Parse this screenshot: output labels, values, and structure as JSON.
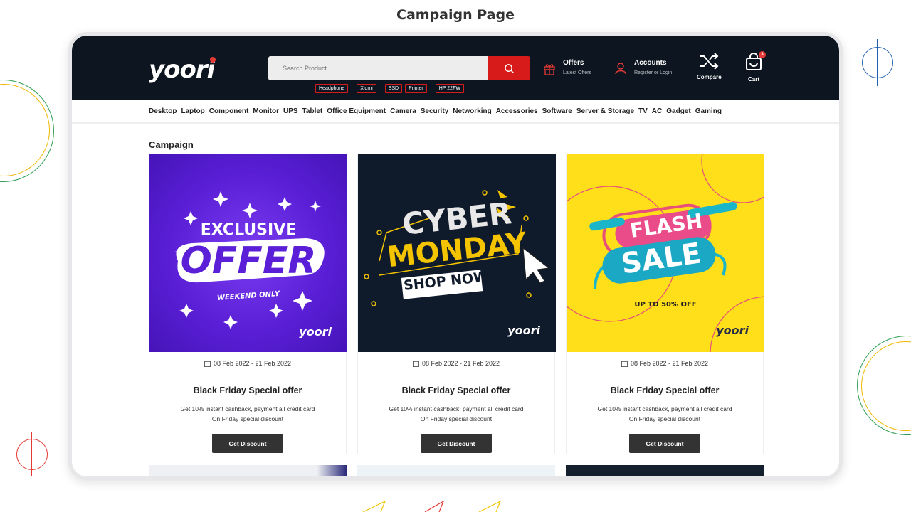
{
  "page_heading": "Campaign Page",
  "header": {
    "logo": "yoori",
    "search_placeholder": "Search Product",
    "tags": [
      "Headphone",
      "Xiomi",
      "SSD",
      "Printer",
      "HP 22FW"
    ],
    "offers": {
      "title": "Offers",
      "subtitle": "Latest Offers"
    },
    "accounts": {
      "title": "Accounts",
      "subtitle": "Register or Login"
    },
    "compare": "Compare",
    "cart": {
      "label": "Cart",
      "count": "3"
    }
  },
  "categories": [
    "Desktop",
    "Laptop",
    "Component",
    "Monitor",
    "UPS",
    "Tablet",
    "Office Equipment",
    "Camera",
    "Security",
    "Networking",
    "Accessories",
    "Software",
    "Server & Storage",
    "TV",
    "AC",
    "Gadget",
    "Gaming"
  ],
  "section_title": "Campaign",
  "campaigns": [
    {
      "banner": {
        "line1": "EXCLUSIVE",
        "line2": "OFFER",
        "line3": "WEEKEND ONLY",
        "brand": "yoori",
        "bg": "#5a1fd6"
      },
      "date": "08 Feb 2022 - 21 Feb 2022",
      "title": "Black Friday Special offer",
      "desc1": "Get 10% instant cashback, payment all credit card",
      "desc2": "On Friday special discount",
      "button": "Get Discount"
    },
    {
      "banner": {
        "line1": "CYBER",
        "line2": "MONDAY",
        "line3": "SHOP NOW",
        "brand": "yoori",
        "bg": "#0f1a2b"
      },
      "date": "08 Feb 2022 - 21 Feb 2022",
      "title": "Black Friday Special offer",
      "desc1": "Get 10% instant cashback, payment all credit card",
      "desc2": "On Friday special discount",
      "button": "Get Discount"
    },
    {
      "banner": {
        "line1": "FLASH",
        "line2": "SALE",
        "line3": "UP TO 50% OFF",
        "brand": "yoori",
        "bg": "#ffde1a"
      },
      "date": "08 Feb 2022 - 21 Feb 2022",
      "title": "Black Friday Special offer",
      "desc1": "Get 10% instant cashback, payment all credit card",
      "desc2": "On Friday special discount",
      "button": "Get Discount"
    }
  ],
  "colors": {
    "topbar": "#0d1620",
    "accent": "#d71b1b",
    "button": "#333333"
  }
}
